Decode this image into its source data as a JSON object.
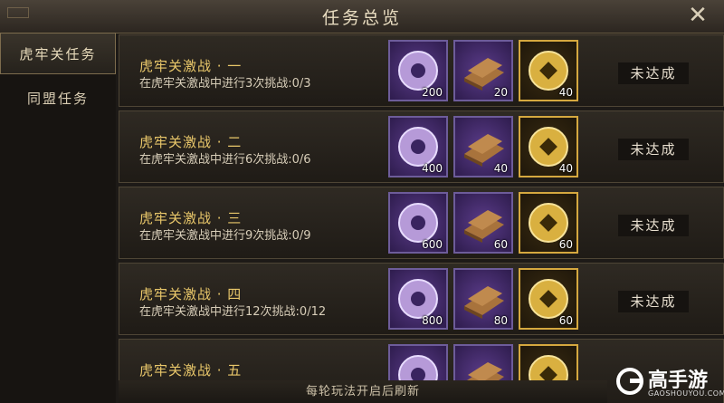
{
  "window": {
    "title": "任务总览"
  },
  "sidebar": {
    "tabs": [
      {
        "label": "虎牢关任务",
        "active": true
      },
      {
        "label": "同盟任务",
        "active": false
      }
    ]
  },
  "tasks": [
    {
      "title": "虎牢关激战 · 一",
      "desc": "在虎牢关激战中进行3次挑战:0/3",
      "rewards": [
        "200",
        "20",
        "40"
      ],
      "status": "未达成"
    },
    {
      "title": "虎牢关激战 · 二",
      "desc": "在虎牢关激战中进行6次挑战:0/6",
      "rewards": [
        "400",
        "40",
        "40"
      ],
      "status": "未达成"
    },
    {
      "title": "虎牢关激战 · 三",
      "desc": "在虎牢关激战中进行9次挑战:0/9",
      "rewards": [
        "600",
        "60",
        "60"
      ],
      "status": "未达成"
    },
    {
      "title": "虎牢关激战 · 四",
      "desc": "在虎牢关激战中进行12次挑战:0/12",
      "rewards": [
        "800",
        "80",
        "60"
      ],
      "status": "未达成"
    },
    {
      "title": "虎牢关激战 · 五"
    }
  ],
  "footer": {
    "text": "每轮玩法开启后刷新"
  },
  "watermark": {
    "brand": "高手游",
    "url": "GAOSHOUYOU.COM"
  }
}
